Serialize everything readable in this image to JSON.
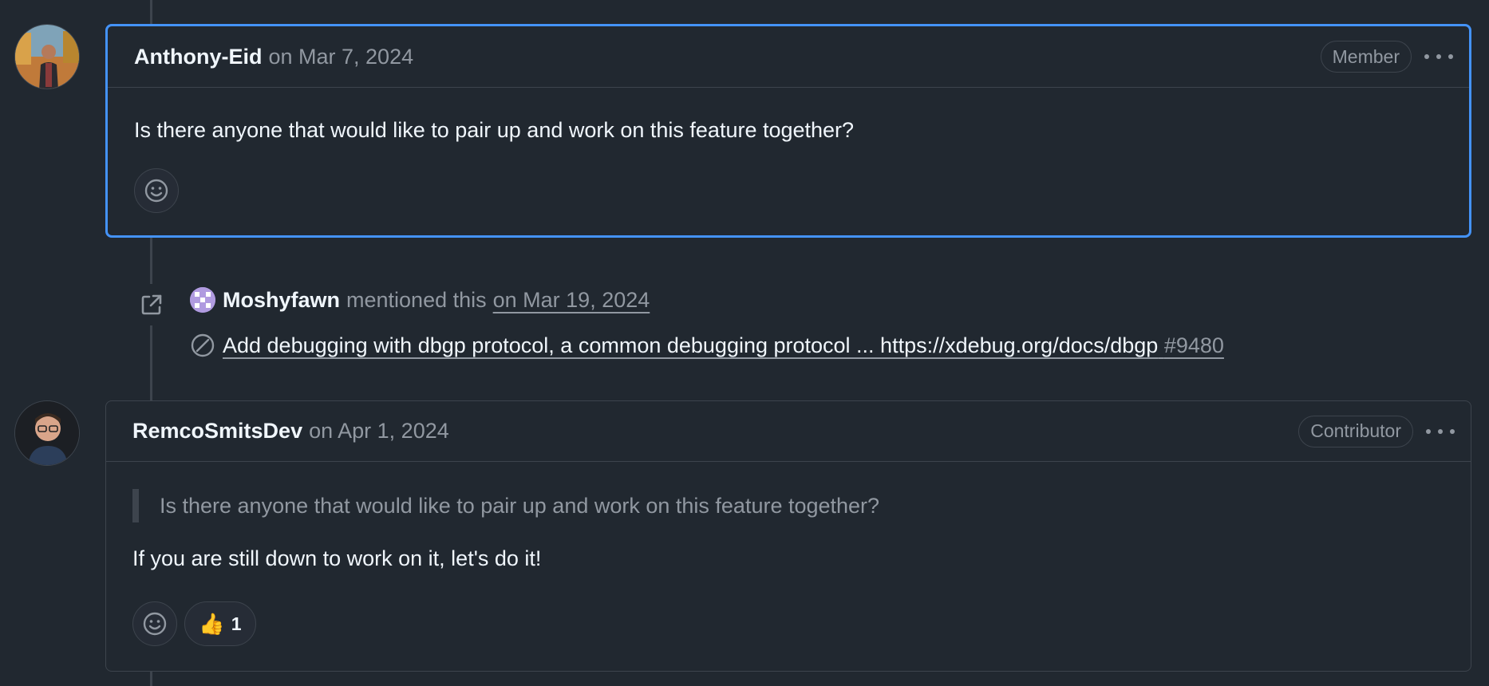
{
  "comments": [
    {
      "author": "Anthony-Eid",
      "date": "on Mar 7, 2024",
      "role": "Member",
      "body": "Is there anyone that would like to pair up and work on this feature together?"
    },
    {
      "author": "RemcoSmitsDev",
      "date": "on Apr 1, 2024",
      "role": "Contributor",
      "quote": "Is there anyone that would like to pair up and work on this feature together?",
      "body": "If you are still down to work on it, let's do it!",
      "reactions": [
        {
          "emoji": "👍",
          "count": "1"
        }
      ]
    }
  ],
  "mention_event": {
    "user": "Moshyfawn",
    "action": "mentioned this",
    "date": "on Mar 19, 2024",
    "issue_title": "Add debugging with dbgp protocol, a common debugging protocol ... https://xdebug.org/docs/dbgp",
    "issue_number": "#9480"
  },
  "colors": {
    "background": "#212830",
    "border": "#3d444d",
    "focus_border": "#4493f8",
    "muted_text": "#9198a1",
    "text": "#f0f6fc"
  },
  "icons": {
    "emoji_picker": "smiley-icon",
    "event": "link-external-icon",
    "issue_state": "issue-closed-skip-icon",
    "more": "kebab-horizontal-icon"
  }
}
